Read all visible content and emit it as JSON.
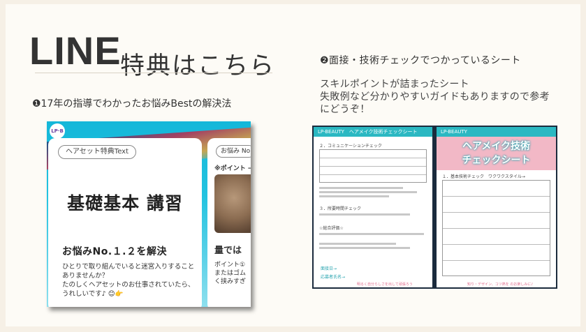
{
  "header": {
    "title_main": "LINE",
    "title_sub": "特典はこちら"
  },
  "left": {
    "heading": "❶17年の指導でわかったお悩みBestの解決法",
    "promo": {
      "logo": "LP·B",
      "tag": "ヘアセット特典Text",
      "big_text": "基礎基本 講習",
      "solve_title": "お悩みNo.１.２を解決",
      "body": "ひとりで取り組んでいると迷宮入りすることありませんか？\nたのしくヘアセットのお仕事されていたら、うれしいです♪ 😊👉",
      "second_tag": "お悩み No",
      "second_point": "※ポイント →",
      "second_title": "量では",
      "second_body": "ポイント①\nまたはゴム\nく挟みすぎ"
    }
  },
  "right": {
    "heading": "❷面接・技術チェックでつかっているシート",
    "desc_line1": "スキルポイントが詰まったシート",
    "desc_line2": "失敗例など分かりやすいガイドもありますので参考",
    "desc_line3": "にどうぞ！",
    "sheet1": {
      "header": "LP-BEAUTY　ヘアメイク技術チェックシート",
      "section1": "２．コミュニケーションチェック",
      "section2": "３．所要時間チェック",
      "section3": "☆総合評価☆",
      "foot1": "面接日→",
      "foot2": "応募者氏名→",
      "pink": "明るく自分らしさを出して頑張ろう"
    },
    "sheet2": {
      "header": "LP-BEAUTY",
      "banner_line1": "ヘアメイク技術",
      "banner_line2": "チェックシート",
      "section1": "１．基本技術チェック　ワクワクスタイル→",
      "pink": "知り・デザイン、コツ熱を のお楽しみに♪"
    }
  }
}
